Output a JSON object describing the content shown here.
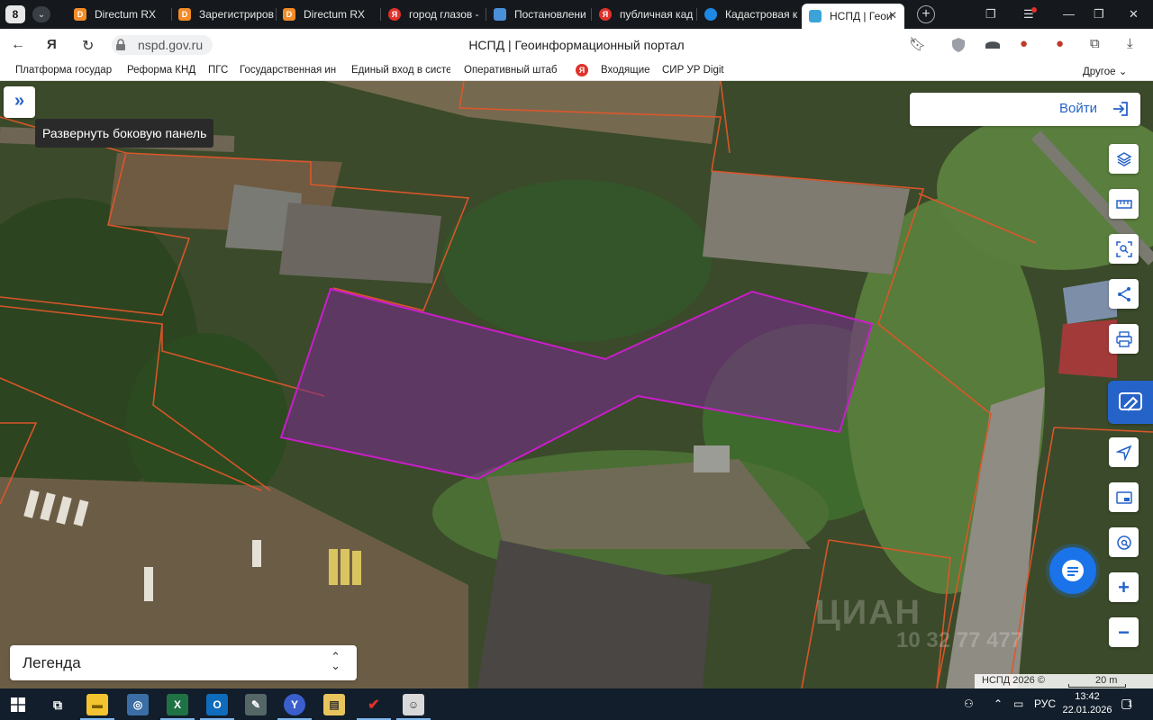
{
  "browser": {
    "tab_count": "8",
    "tabs": [
      {
        "label": "Directum RX",
        "color": "#f28c28"
      },
      {
        "label": "Зарегистриров",
        "color": "#f28c28"
      },
      {
        "label": "Directum RX",
        "color": "#f28c28"
      },
      {
        "label": "город глазов -",
        "color": "#e0312a"
      },
      {
        "label": "Постановлени",
        "color": "#4a90d9"
      },
      {
        "label": "публичная кад",
        "color": "#e0312a"
      },
      {
        "label": "Кадастровая к",
        "color": "#1e88e5"
      },
      {
        "label": "НСПД | Геои",
        "color": "#3ba3d8"
      }
    ],
    "url": "nspd.gov.ru",
    "page_title": "НСПД | Геоинформационный портал",
    "bookmarks": [
      "Платформа государ",
      "Реформа КНД",
      "ПГС",
      "Государственная ин",
      "Единый вход в систе",
      "Оперативный штаб",
      "Входящие",
      "СИР УР Digit"
    ],
    "bookmarks_other": "Другое"
  },
  "map": {
    "sidebar_tooltip": "Развернуть боковую панель",
    "login_label": "Войти",
    "legend_label": "Легенда",
    "copyright": "НСПД 2026 ©",
    "scale_label": "20 m",
    "watermark": "ЦИАН",
    "watermark_phone": "10 32 77 477",
    "accent_color": "#2563c9",
    "parcel_color": "#c81ec8",
    "boundary_color": "#e0562a"
  },
  "taskbar": {
    "language": "РУС",
    "time": "13:42",
    "date": "22.01.2026",
    "notifications": "1"
  }
}
